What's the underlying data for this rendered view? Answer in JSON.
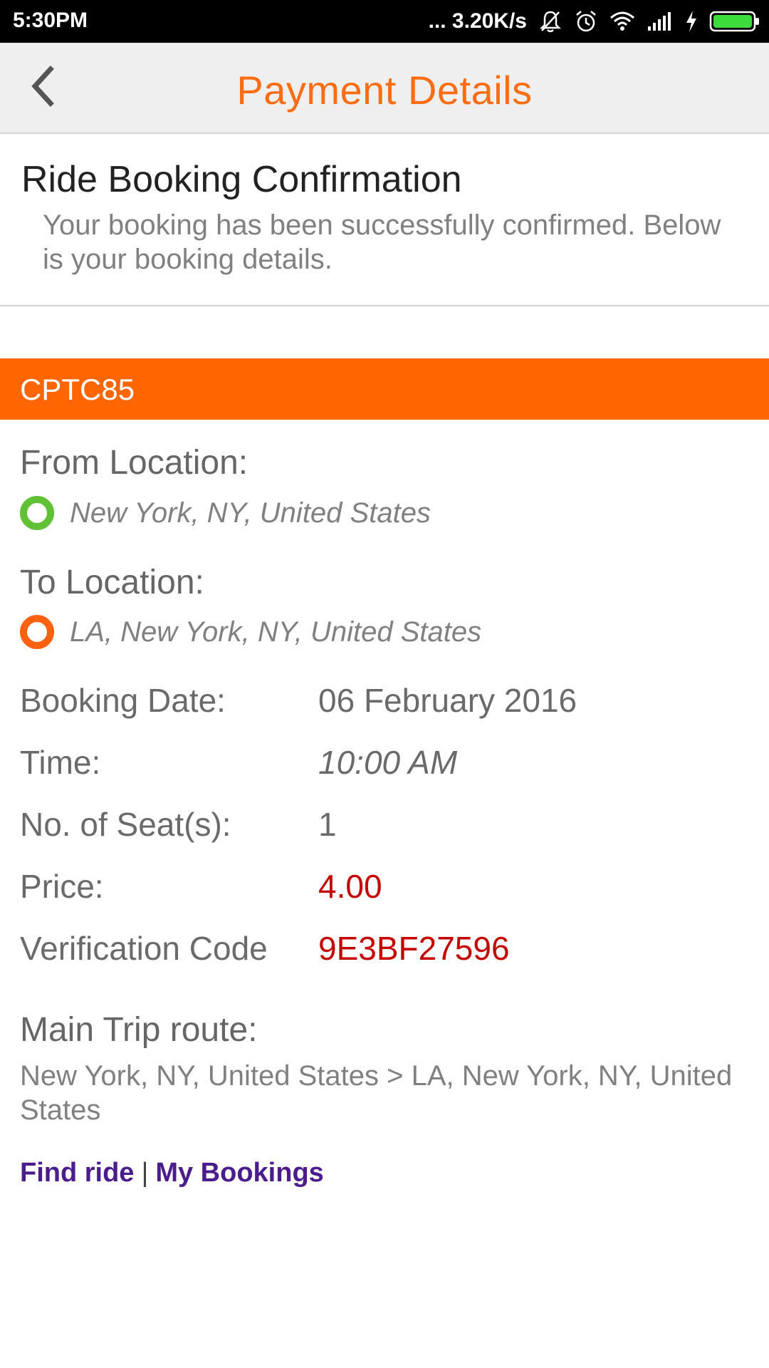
{
  "status_bar": {
    "time": "5:30PM",
    "net_speed": "... 3.20K/s",
    "icons": [
      "bell-off-icon",
      "alarm-icon",
      "wifi-icon",
      "signal-icon",
      "charging-icon",
      "battery-icon"
    ]
  },
  "header": {
    "back_icon": "chevron-left-icon",
    "title": "Payment Details"
  },
  "confirmation": {
    "title": "Ride Booking Confirmation",
    "message": "Your booking has been successfully confirmed. Below is your booking details."
  },
  "booking_code": "CPTC85",
  "from": {
    "label": "From Location:",
    "value": "New York, NY, United States",
    "marker_color": "#5fc133"
  },
  "to": {
    "label": "To Location:",
    "value": "LA, New York, NY, United States",
    "marker_color": "#ff6111"
  },
  "details": {
    "booking_date": {
      "label": "Booking Date:",
      "value": "06 February 2016"
    },
    "time": {
      "label": "Time:",
      "value": "10:00 AM"
    },
    "seats": {
      "label": "No. of Seat(s):",
      "value": "1"
    },
    "price": {
      "label": "Price:",
      "value": "4.00"
    },
    "verification": {
      "label": "Verification Code",
      "value": "9E3BF27596"
    }
  },
  "route": {
    "label": "Main Trip route:",
    "value": "New York, NY, United States > LA, New York, NY, United States"
  },
  "links": {
    "find_ride": "Find ride",
    "separator": "|",
    "my_bookings": "My Bookings"
  },
  "colors": {
    "accent": "#ff6600",
    "title_orange": "#fb6d12",
    "value_red": "#c40000",
    "link_purple": "#4b1c8c"
  }
}
